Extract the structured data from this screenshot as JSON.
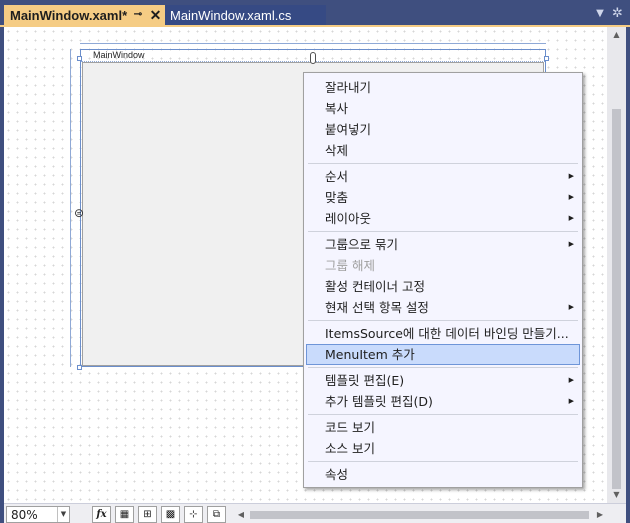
{
  "tabs": [
    {
      "label": "MainWindow.xaml*",
      "active": true
    },
    {
      "label": "MainWindow.xaml.cs",
      "active": false
    }
  ],
  "tab_icons": {
    "pin": "pin-icon",
    "close": "close-icon",
    "dropdown": "chevron-down-icon",
    "settings": "gear-icon"
  },
  "designer": {
    "window_title": "MainWindow"
  },
  "context_menu": {
    "items": [
      {
        "label": "잘라내기"
      },
      {
        "label": "복사"
      },
      {
        "label": "붙여넣기"
      },
      {
        "label": "삭제"
      },
      {
        "label": "순서",
        "submenu": true
      },
      {
        "label": "맞춤",
        "submenu": true
      },
      {
        "label": "레이아웃",
        "submenu": true
      },
      {
        "label": "그룹으로 묶기",
        "submenu": true
      },
      {
        "label": "그룹 해제",
        "disabled": true
      },
      {
        "label": "활성 컨테이너 고정"
      },
      {
        "label": "현재 선택 항목 설정",
        "submenu": true
      },
      {
        "label": "ItemsSource에 대한 데이터 바인딩 만들기..."
      },
      {
        "label": "MenuItem 추가",
        "highlighted": true
      },
      {
        "label": "템플릿 편집(E)",
        "submenu": true
      },
      {
        "label": "추가 템플릿 편집(D)",
        "submenu": true
      },
      {
        "label": "코드 보기"
      },
      {
        "label": "소스 보기"
      },
      {
        "label": "속성"
      }
    ]
  },
  "toolbar": {
    "zoom": "80%",
    "fx_label": "fx",
    "buttons": [
      "grid-icon",
      "snap-gridlines-icon",
      "artboard-background-icon",
      "snap-snaplines-icon",
      "layout-rounding-icon"
    ]
  },
  "colors": {
    "chrome": "#3f4f7f",
    "active_tab": "#f5cc84",
    "inactive_tab": "#364a84",
    "menu_background": "#f5f5ff",
    "menu_highlight": "#c9dbfc"
  }
}
